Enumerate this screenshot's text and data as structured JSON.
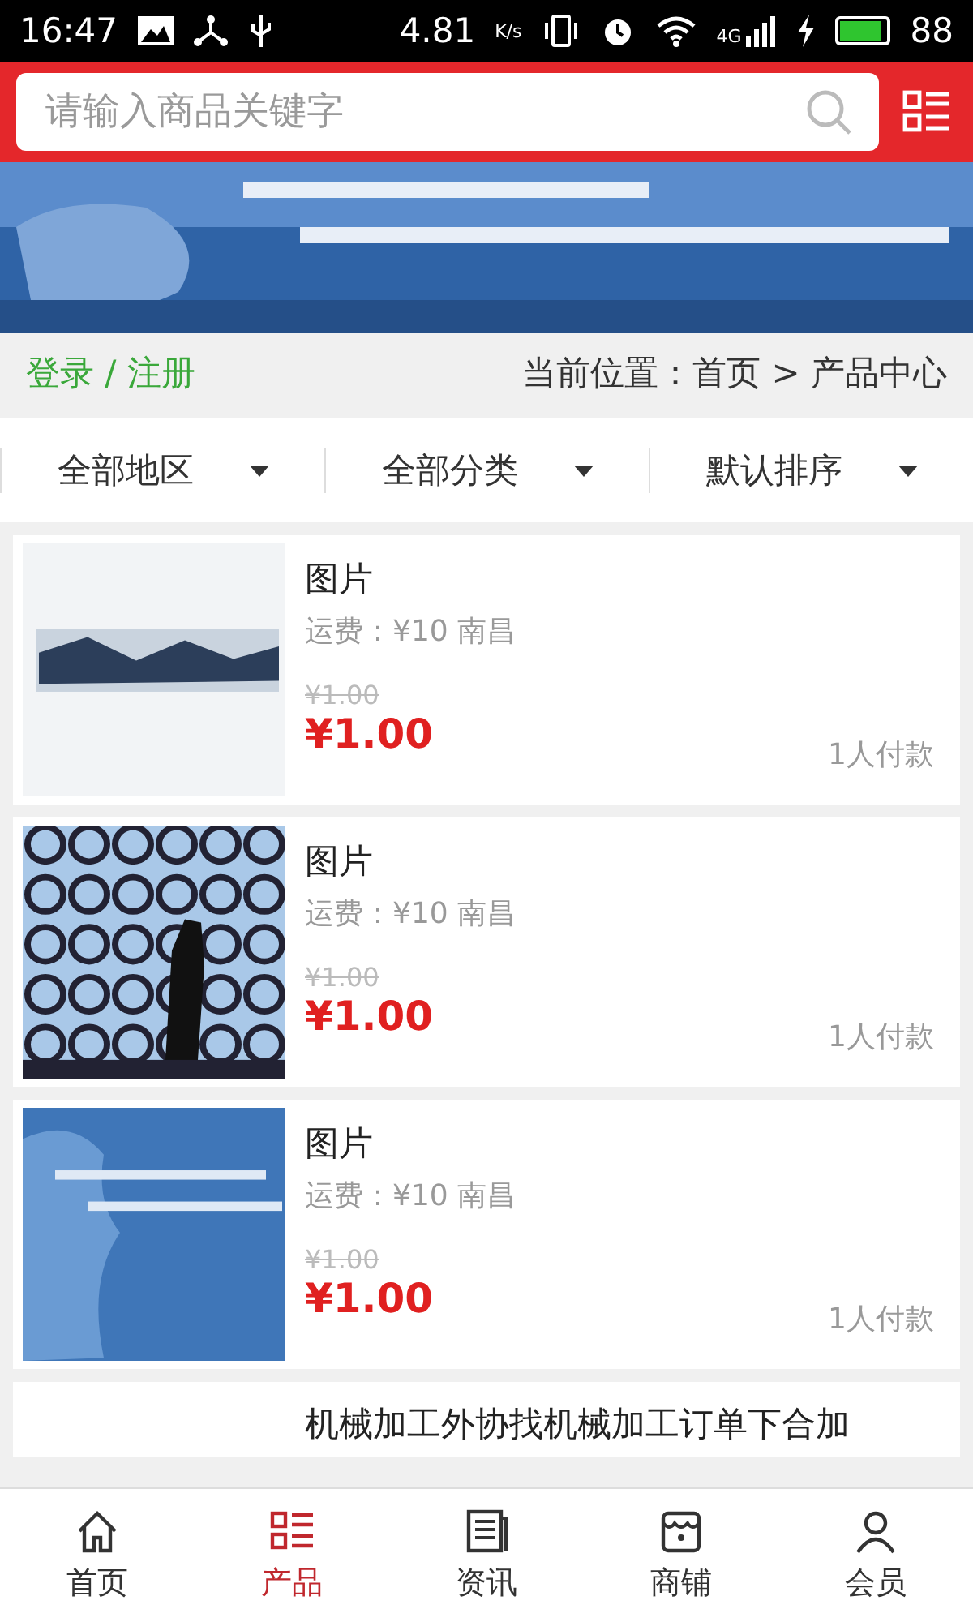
{
  "status_bar": {
    "time": "16:47",
    "speed": "4.81",
    "speed_unit": "K/s",
    "network": "4G",
    "battery": "88"
  },
  "search": {
    "placeholder": "请输入商品关键字"
  },
  "breadcrumb": {
    "login": "登录 / 注册",
    "location": "当前位置：首页 > 产品中心"
  },
  "filters": [
    {
      "label": "全部地区"
    },
    {
      "label": "全部分类"
    },
    {
      "label": "默认排序"
    }
  ],
  "products": [
    {
      "title": "图片",
      "shipping": "运费：¥10 南昌",
      "old_price": "¥1.00",
      "price": "¥1.00",
      "sales": "1人付款"
    },
    {
      "title": "图片",
      "shipping": "运费：¥10 南昌",
      "old_price": "¥1.00",
      "price": "¥1.00",
      "sales": "1人付款"
    },
    {
      "title": "图片",
      "shipping": "运费：¥10 南昌",
      "old_price": "¥1.00",
      "price": "¥1.00",
      "sales": "1人付款"
    },
    {
      "title": "机械加工外协找机械加工订单下合加"
    }
  ],
  "tabs": [
    {
      "label": "首页",
      "selected": false
    },
    {
      "label": "产品",
      "selected": true
    },
    {
      "label": "资讯",
      "selected": false
    },
    {
      "label": "商铺",
      "selected": false
    },
    {
      "label": "会员",
      "selected": false
    }
  ]
}
